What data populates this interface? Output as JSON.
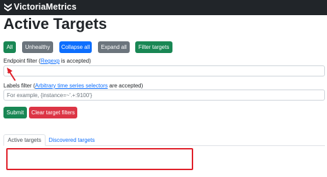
{
  "navbar": {
    "brand": "VictoriaMetrics",
    "logo_icon": "victoriametrics-logo-icon"
  },
  "page": {
    "title": "Active Targets"
  },
  "toolbar": {
    "all_label": "All",
    "unhealthy_label": "Unhealthy",
    "collapse_label": "Collapse all",
    "expand_label": "Expand all",
    "filter_label": "Filter targets"
  },
  "endpoint_filter": {
    "label_prefix": "Endpoint filter (",
    "link_text": "Regexp",
    "label_suffix": " is accepted)",
    "value": ".*"
  },
  "labels_filter": {
    "label_prefix": "Labels filter (",
    "link_text": "Arbitrary time series selectors",
    "label_suffix": " are accepted)",
    "placeholder": "For example, {instance=~'.+:9100'}"
  },
  "actions": {
    "submit_label": "Submit",
    "clear_label": "Clear target filters"
  },
  "tabs": [
    {
      "label": "Active targets",
      "active": true
    },
    {
      "label": "Discovered targets",
      "active": false
    }
  ],
  "colors": {
    "navbar": "#212529",
    "success": "#198754",
    "secondary": "#6c757d",
    "primary": "#0d6efd",
    "danger": "#dc3545",
    "annotation": "#e0202a"
  }
}
